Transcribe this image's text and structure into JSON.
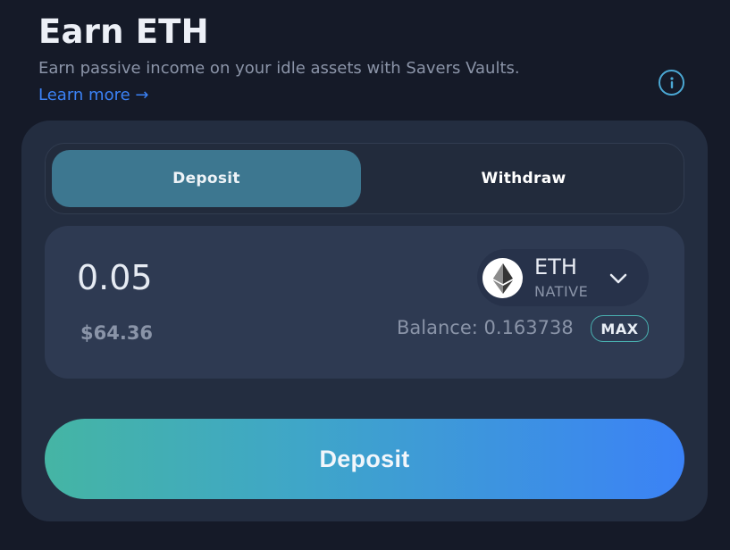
{
  "header": {
    "title": "Earn ETH",
    "subtitle": "Earn passive income on your idle assets with Savers Vaults.",
    "learn_more": "Learn more →",
    "info_icon": "info-icon"
  },
  "tabs": [
    {
      "label": "Deposit",
      "active": true
    },
    {
      "label": "Withdraw",
      "active": false
    }
  ],
  "amount": {
    "value": "0.05",
    "usd_value": "$64.36"
  },
  "token": {
    "symbol": "ETH",
    "type": "NATIVE",
    "icon": "ethereum-icon"
  },
  "balance": {
    "text": "Balance: 0.163738",
    "max_label": "MAX"
  },
  "action": {
    "label": "Deposit"
  },
  "colors": {
    "background": "#151a28",
    "card": "#232d40",
    "active_tab": "#3d7790",
    "link": "#3b82f6",
    "gradient_start": "#45b5a4",
    "gradient_end": "#3b82f6"
  }
}
